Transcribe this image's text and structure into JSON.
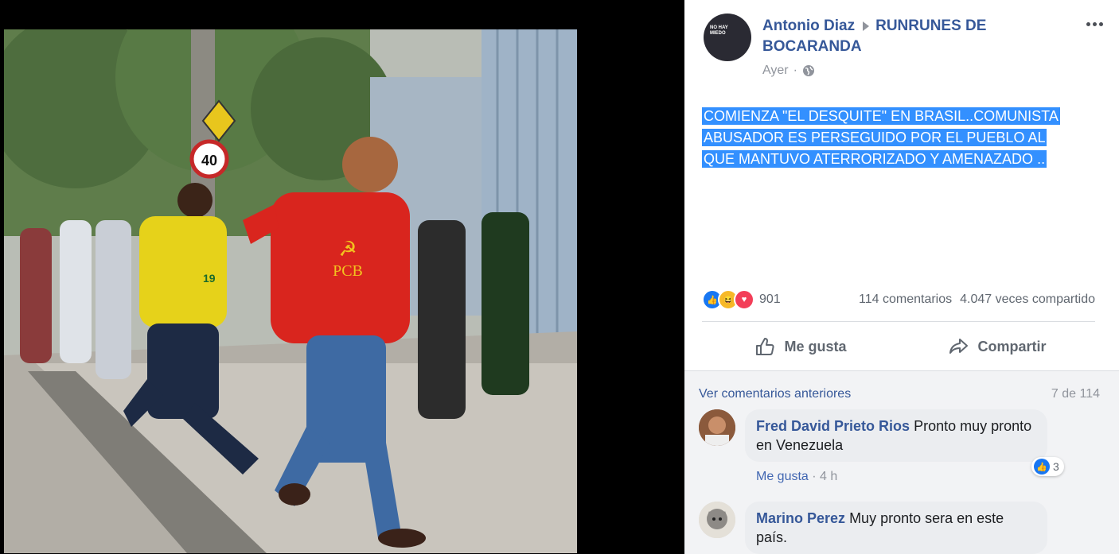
{
  "post": {
    "author": "Antonio Diaz",
    "group": "RUNRUNES DE BOCARANDA",
    "time": "Ayer",
    "avatar_text": "NO HAY MIEDO",
    "text": "COMIENZA \"EL DESQUITE\" EN BRASIL..COMUNISTA ABUSADOR ES PERSEGUIDO POR EL PUEBLO AL QUE MANTUVO ATERRORIZADO Y AMENAZADO .."
  },
  "photo": {
    "sign_speed": "40",
    "shirt_text": "PCB",
    "jersey_number": "19"
  },
  "stats": {
    "reactions": "901",
    "comments": "114 comentarios",
    "shares": "4.047 veces compartido"
  },
  "actions": {
    "like": "Me gusta",
    "share": "Compartir"
  },
  "comments": {
    "previous_label": "Ver comentarios anteriores",
    "count_label": "7 de 114",
    "items": [
      {
        "name": "Fred David Prieto Rios",
        "text": "Pronto muy pronto en Venezuela",
        "like_label": "Me gusta",
        "time": "4 h",
        "reactions": "3"
      },
      {
        "name": "Marino Perez",
        "text": "Muy pronto sera en este país."
      }
    ]
  },
  "colors": {
    "link": "#365899",
    "highlight": "#3390ff",
    "like_blue": "#1877f2"
  },
  "icons": [
    "globe-icon",
    "more-icon",
    "like-icon",
    "share-icon"
  ]
}
